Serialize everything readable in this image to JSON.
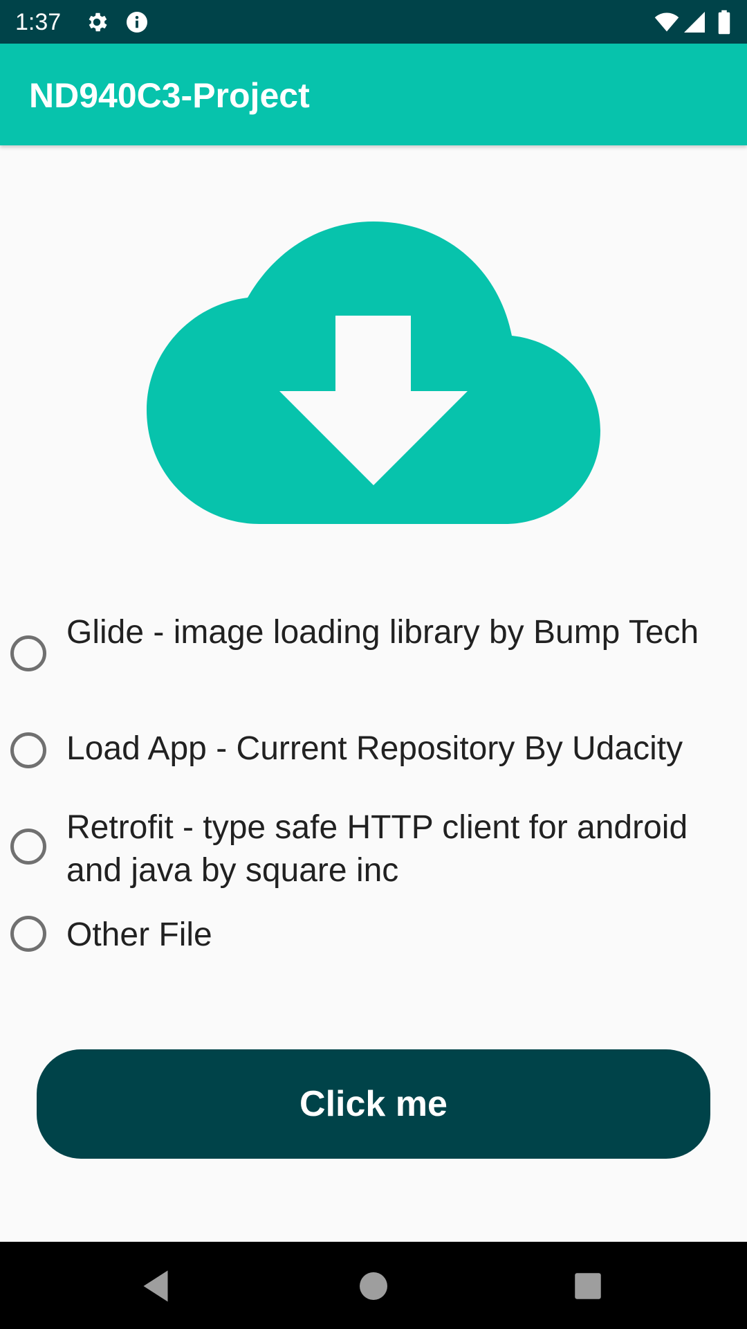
{
  "status_bar": {
    "time": "1:37",
    "icons": [
      "settings-gear-icon",
      "info-icon",
      "wifi-icon",
      "cell-signal-icon",
      "battery-icon"
    ]
  },
  "app_bar": {
    "title": "ND940C3-Project",
    "color": "#07c3ac"
  },
  "hero": {
    "icon": "cloud-download-icon",
    "color": "#07c3ac"
  },
  "download_options": [
    {
      "label": "Glide - image loading library by Bump Tech",
      "selected": false
    },
    {
      "label": "Load App - Current Repository By Udacity",
      "selected": false
    },
    {
      "label": "Retrofit - type safe HTTP client for android and java by square inc",
      "selected": false
    },
    {
      "label": "Other File",
      "selected": false
    }
  ],
  "action_button": {
    "label": "Click me",
    "color": "#004349"
  },
  "nav_bar": {
    "buttons": [
      "back-icon",
      "home-icon",
      "recents-icon"
    ]
  },
  "colors": {
    "primary_dark": "#004349",
    "accent": "#07c3ac",
    "background": "#fafafa"
  }
}
